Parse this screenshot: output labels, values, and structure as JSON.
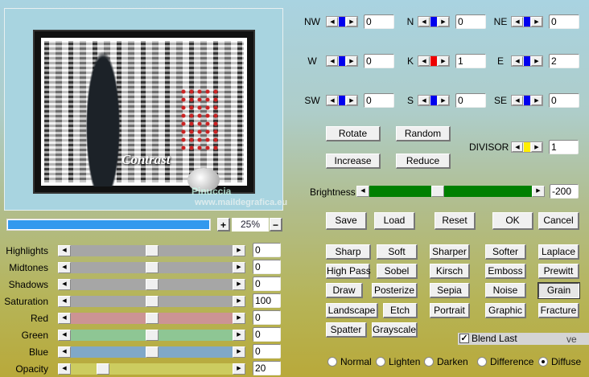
{
  "preview": {
    "image_text": "Contrast",
    "watermark_line1": "Pinuccia",
    "watermark_line2": "www.maildegrafica.eu"
  },
  "zoom": {
    "progress_percent": 100,
    "plus": "+",
    "minus": "−",
    "value": "25%",
    "progress_color": "#3399ee"
  },
  "matrix": [
    {
      "label": "NW",
      "value": "0",
      "thumb_color": "#0000ee"
    },
    {
      "label": "N",
      "value": "0",
      "thumb_color": "#0000ee"
    },
    {
      "label": "NE",
      "value": "0",
      "thumb_color": "#0000ee"
    },
    {
      "label": "W",
      "value": "0",
      "thumb_color": "#0000ee"
    },
    {
      "label": "K",
      "value": "1",
      "thumb_color": "#ee0000"
    },
    {
      "label": "E",
      "value": "2",
      "thumb_color": "#0000ee"
    },
    {
      "label": "SW",
      "value": "0",
      "thumb_color": "#0000ee"
    },
    {
      "label": "S",
      "value": "0",
      "thumb_color": "#0000ee"
    },
    {
      "label": "SE",
      "value": "0",
      "thumb_color": "#0000ee"
    }
  ],
  "matrix_buttons": {
    "rotate": "Rotate",
    "random": "Random",
    "increase": "Increase",
    "reduce": "Reduce"
  },
  "divisor": {
    "label": "DIVISOR",
    "value": "1",
    "thumb_color": "#ffee00"
  },
  "brightness": {
    "label": "Brightness",
    "value": "-200",
    "track_color": "#008000",
    "position_fraction": 0.42
  },
  "actions": {
    "save": "Save",
    "load": "Load",
    "reset": "Reset",
    "ok": "OK",
    "cancel": "Cancel"
  },
  "adjust": [
    {
      "label": "Highlights",
      "value": "0",
      "track_color": "#a6a6a6",
      "position_fraction": 0.5
    },
    {
      "label": "Midtones",
      "value": "0",
      "track_color": "#a6a6a6",
      "position_fraction": 0.5
    },
    {
      "label": "Shadows",
      "value": "0",
      "track_color": "#a6a6a6",
      "position_fraction": 0.5
    },
    {
      "label": "Saturation",
      "value": "100",
      "track_color": "#a6a6a6",
      "position_fraction": 0.5
    },
    {
      "label": "Red",
      "value": "0",
      "track_color": "#cc9494",
      "position_fraction": 0.5
    },
    {
      "label": "Green",
      "value": "0",
      "track_color": "#8ec694",
      "position_fraction": 0.5
    },
    {
      "label": "Blue",
      "value": "0",
      "track_color": "#80a8c8",
      "position_fraction": 0.5
    },
    {
      "label": "Opacity",
      "value": "20",
      "track_color": "#cccc60",
      "position_fraction": 0.2
    }
  ],
  "filters": [
    {
      "label": "Sharp"
    },
    {
      "label": "Soft"
    },
    {
      "label": "Sharper"
    },
    {
      "label": "Softer"
    },
    {
      "label": "Laplace"
    },
    {
      "label": "High Pass"
    },
    {
      "label": "Sobel"
    },
    {
      "label": "Kirsch"
    },
    {
      "label": "Emboss"
    },
    {
      "label": "Prewitt"
    },
    {
      "label": "Draw"
    },
    {
      "label": "Posterize"
    },
    {
      "label": "Sepia"
    },
    {
      "label": "Noise"
    },
    {
      "label": "Grain",
      "pressed": true
    },
    {
      "label": "Landscape"
    },
    {
      "label": "Etch"
    },
    {
      "label": "Portrait"
    },
    {
      "label": "Graphic"
    },
    {
      "label": "Fracture"
    },
    {
      "label": "Spatter"
    },
    {
      "label": "Grayscale"
    }
  ],
  "blend_last": {
    "label": "Blend Last",
    "checked": true,
    "trailing_text": "ve"
  },
  "blend_modes": [
    {
      "label": "Normal",
      "selected": false
    },
    {
      "label": "Lighten",
      "selected": false
    },
    {
      "label": "Darken",
      "selected": false
    },
    {
      "label": "Difference",
      "selected": false
    },
    {
      "label": "Diffuse",
      "selected": true
    }
  ]
}
